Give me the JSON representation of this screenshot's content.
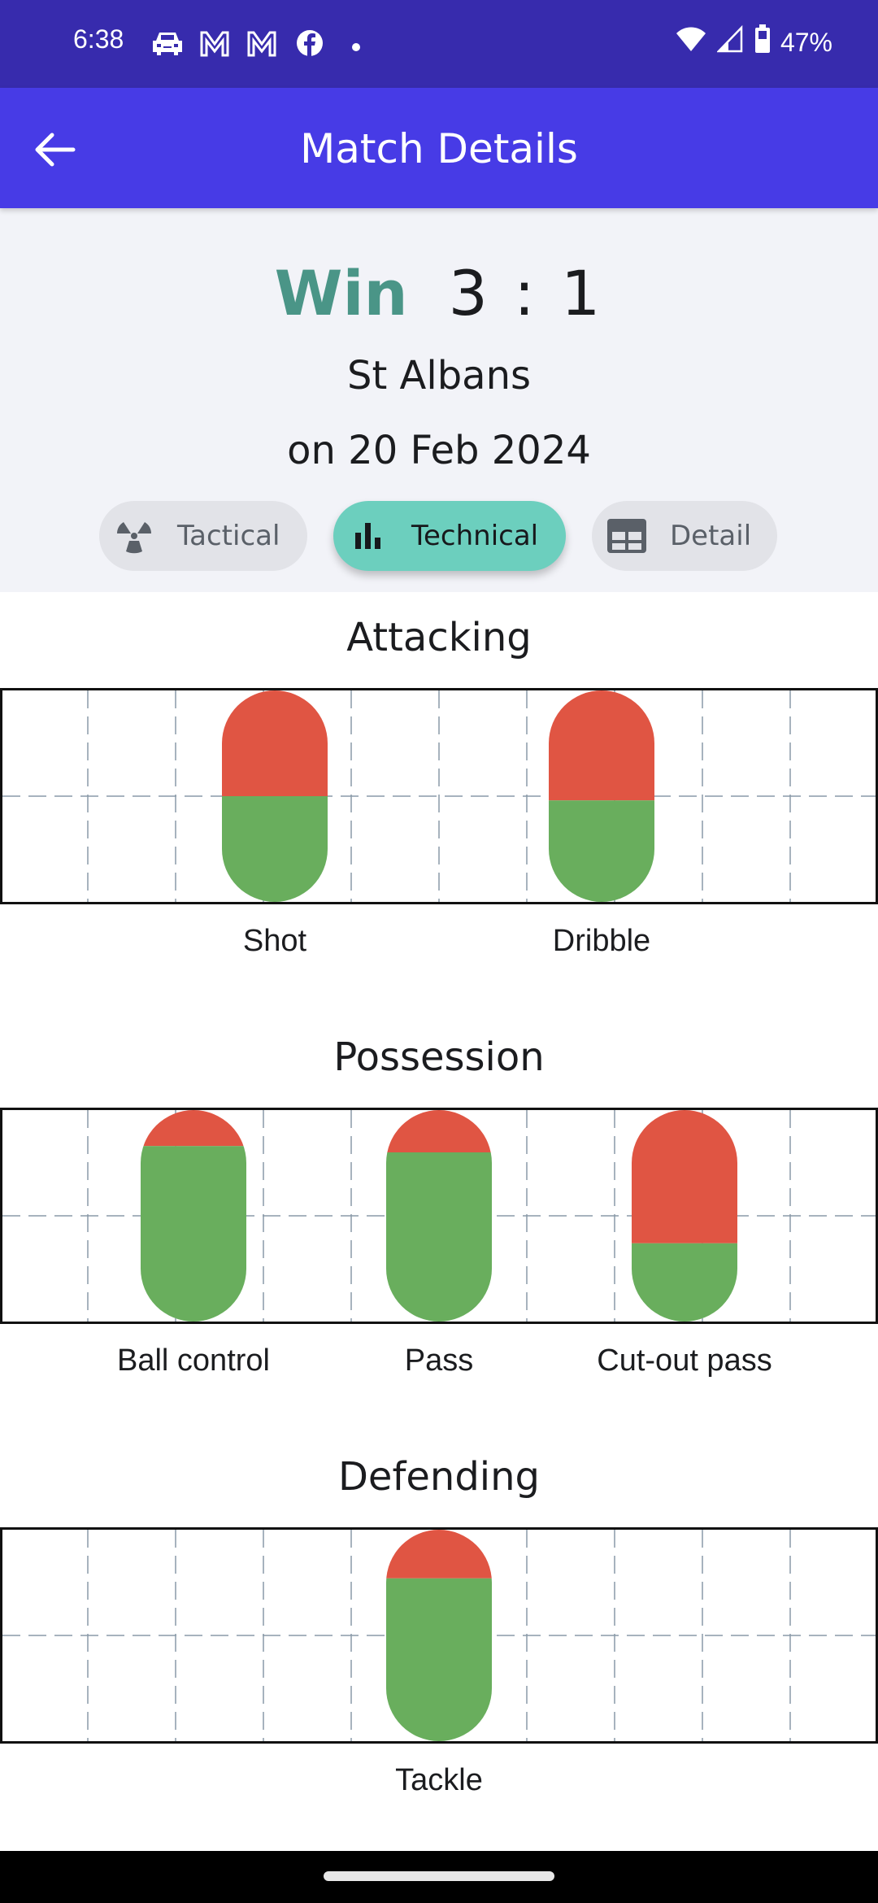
{
  "status_bar": {
    "time": "6:38",
    "left_icons": [
      "car-icon",
      "gmail-icon",
      "gmail-icon",
      "facebook-icon",
      "dot-icon"
    ],
    "right_icons": [
      "wifi-icon",
      "signal-icon",
      "battery-icon"
    ],
    "battery": "47%"
  },
  "app_bar": {
    "title": "Match Details",
    "back_icon": "arrow-left-icon"
  },
  "match": {
    "result": "Win",
    "score": "3 : 1",
    "opponent": "St Albans",
    "date": "on 20 Feb 2024",
    "result_color": "#4a9587"
  },
  "tabs": [
    {
      "label": "Tactical",
      "icon": "radiation-icon",
      "active": false
    },
    {
      "label": "Technical",
      "icon": "bar-chart-icon",
      "active": true
    },
    {
      "label": "Detail",
      "icon": "table-icon",
      "active": false
    }
  ],
  "colors": {
    "unsuccessful": "#e05543",
    "successful": "#69ae5d",
    "active_tab": "#6ccfbe",
    "app_bar": "#473be6",
    "status_bar": "#372bad"
  },
  "chart_data": [
    {
      "type": "bar",
      "title": "Attacking",
      "categories": [
        "Shot",
        "Dribble"
      ],
      "series": [
        {
          "name": "successful",
          "color": "#69ae5d",
          "values": [
            0.5,
            0.48
          ]
        },
        {
          "name": "unsuccessful",
          "color": "#e05543",
          "values": [
            0.5,
            0.52
          ]
        }
      ],
      "stacked": true,
      "ylim": [
        0,
        1
      ],
      "grid": true
    },
    {
      "type": "bar",
      "title": "Possession",
      "categories": [
        "Ball control",
        "Pass",
        "Cut-out pass"
      ],
      "series": [
        {
          "name": "successful",
          "color": "#69ae5d",
          "values": [
            0.83,
            0.8,
            0.37
          ]
        },
        {
          "name": "unsuccessful",
          "color": "#e05543",
          "values": [
            0.17,
            0.2,
            0.63
          ]
        }
      ],
      "stacked": true,
      "ylim": [
        0,
        1
      ],
      "grid": true
    },
    {
      "type": "bar",
      "title": "Defending",
      "categories": [
        "Tackle"
      ],
      "series": [
        {
          "name": "successful",
          "color": "#69ae5d",
          "values": [
            0.77
          ]
        },
        {
          "name": "unsuccessful",
          "color": "#e05543",
          "values": [
            0.23
          ]
        }
      ],
      "stacked": true,
      "ylim": [
        0,
        1
      ],
      "grid": true
    }
  ]
}
